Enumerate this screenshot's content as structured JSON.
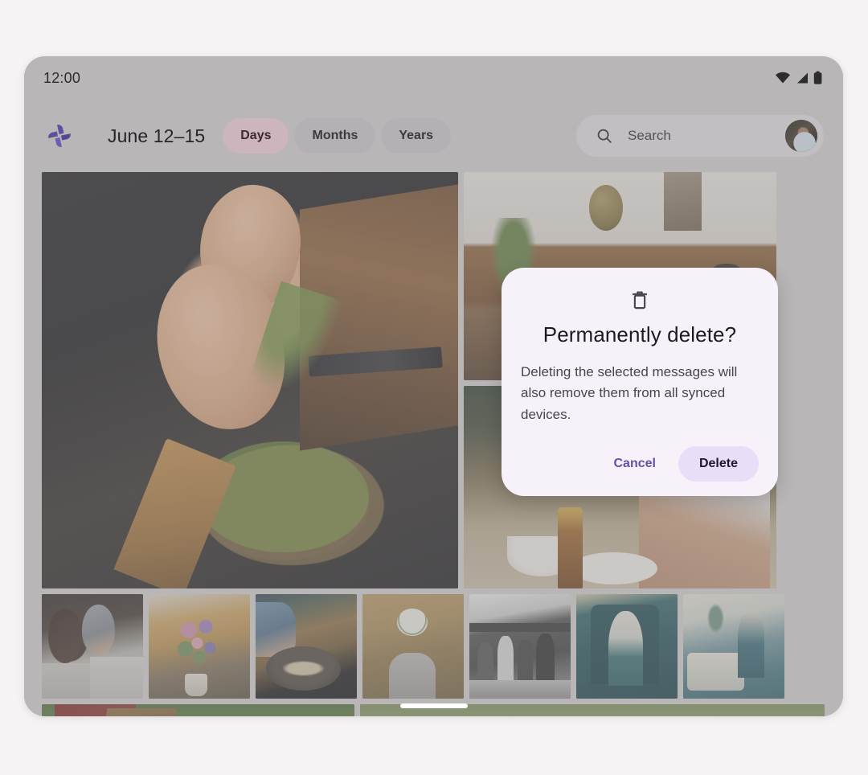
{
  "device": {
    "status_bar": {
      "time": "12:00",
      "icons": [
        "wifi-icon",
        "signal-icon",
        "battery-icon"
      ]
    },
    "home_indicator": "home-indicator"
  },
  "app_bar": {
    "logo_icon": "google-photos-pinwheel-icon",
    "date_range": "June 12–15",
    "chips": [
      {
        "label": "Days",
        "selected": true
      },
      {
        "label": "Months",
        "selected": false
      },
      {
        "label": "Years",
        "selected": false
      }
    ],
    "search": {
      "icon": "search-icon",
      "placeholder": "Search",
      "value": ""
    },
    "avatar": "user-avatar"
  },
  "grid": {
    "rows": [
      {
        "cells": [
          {
            "name": "photo-cooking-hands",
            "alt": "hands sprinkling herbs over a pan of mushrooms"
          },
          {
            "name": "photo-group-in-room",
            "alt": "group of friends covering faces in a room"
          },
          {
            "name": "photo-table-with-bottle",
            "alt": "people at a table with bowls and a bottle"
          }
        ]
      },
      {
        "cells": [
          {
            "name": "photo-couple-drinking",
            "alt": "two people drinking at a table"
          },
          {
            "name": "photo-flower-bouquet",
            "alt": "bouquet of flowers on a table"
          },
          {
            "name": "photo-skillet-cooking",
            "alt": "person cooking mushrooms in a skillet"
          },
          {
            "name": "photo-lunch-table",
            "alt": "person at a wooden lunch table"
          },
          {
            "name": "photo-bw-group",
            "alt": "black and white photo of a group"
          },
          {
            "name": "photo-teal-portrait",
            "alt": "teal toned portrait of a seated person"
          },
          {
            "name": "photo-teal-room",
            "alt": "teal toned photo of people in a room"
          }
        ]
      },
      {
        "cells": [
          {
            "name": "photo-camp-grass",
            "alt": "tent on grass"
          },
          {
            "name": "photo-field-grass",
            "alt": "grassy field"
          }
        ]
      }
    ]
  },
  "dialog": {
    "icon": "trash-icon",
    "title": "Permanently delete?",
    "body": "Deleting the selected messages will also remove them from all synced devices.",
    "cancel_label": "Cancel",
    "confirm_label": "Delete"
  },
  "colors": {
    "page_background": "#f5f3f4",
    "device_frame": "#b9b6b8",
    "chip_selected": "#ccb5bd",
    "chip_default": "#b4b1b6",
    "dialog_surface": "#f7f2f9",
    "dialog_tonal_button": "#e8def8",
    "cancel_text": "#6750a4",
    "title_text": "#1d1b20",
    "body_text": "#49454e"
  }
}
